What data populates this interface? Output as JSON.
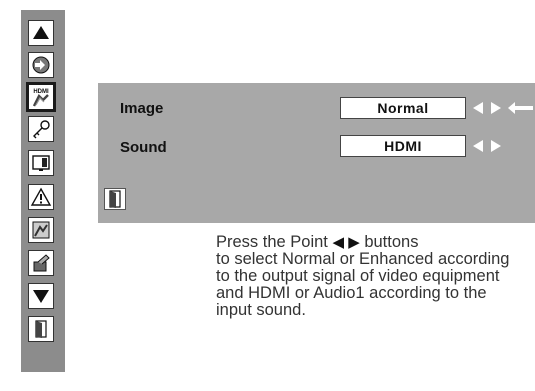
{
  "sidebar": {
    "items": [
      {
        "icon": "arrow-up-icon"
      },
      {
        "icon": "input-icon"
      },
      {
        "icon": "hdmi-icon",
        "label": "HDMI",
        "selected": true
      },
      {
        "icon": "key-icon"
      },
      {
        "icon": "screen-icon"
      },
      {
        "icon": "warning-icon"
      },
      {
        "icon": "image-settings-icon"
      },
      {
        "icon": "tools-icon"
      },
      {
        "icon": "arrow-down-icon"
      },
      {
        "icon": "exit-icon"
      }
    ]
  },
  "menu": {
    "rows": [
      {
        "label": "Image",
        "value": "Normal"
      },
      {
        "label": "Sound",
        "value": "HDMI"
      }
    ]
  },
  "description": {
    "line1_before": "Press the Point ",
    "arrows": "◀ ▶",
    "line1_after": " buttons",
    "rest": "to select Normal or Enhanced according to the output signal of video equipment and HDMI or Audio1 according to the input sound."
  }
}
